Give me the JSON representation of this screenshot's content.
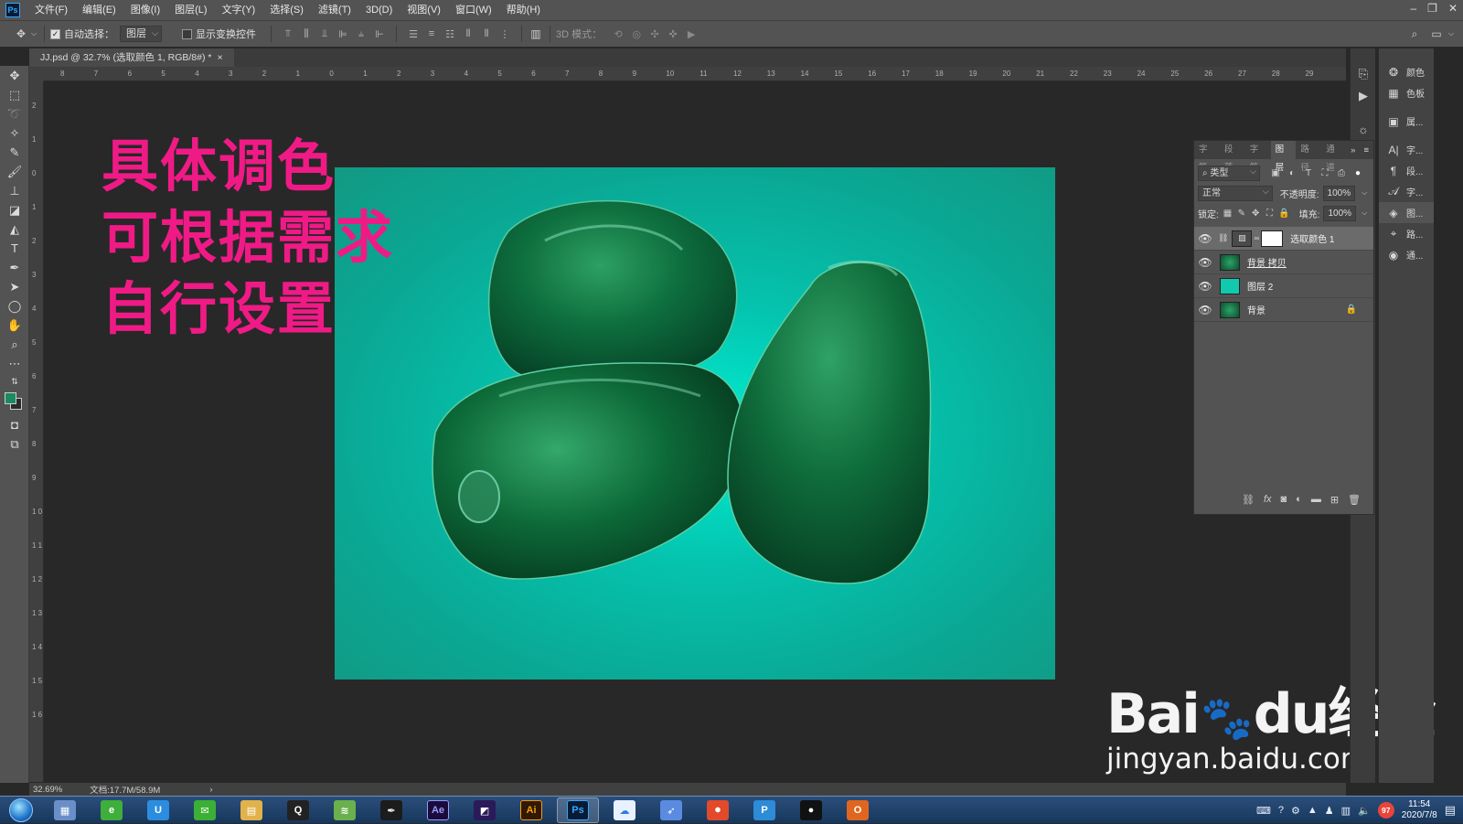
{
  "app": {
    "logo": "Ps",
    "menu": [
      "文件(F)",
      "编辑(E)",
      "图像(I)",
      "图层(L)",
      "文字(Y)",
      "选择(S)",
      "滤镜(T)",
      "3D(D)",
      "视图(V)",
      "窗口(W)",
      "帮助(H)"
    ]
  },
  "options_bar": {
    "auto_select_label": "自动选择：",
    "auto_select_checked": true,
    "auto_select_target": "图层",
    "show_transform_label": "显示变换控件",
    "show_transform_checked": false,
    "mode_3d_label": "3D 模式："
  },
  "document": {
    "tab_title": "JJ.psd @ 32.7% (选取颜色 1, RGB/8#) *",
    "close": "×",
    "zoom": "32.69%",
    "doc_size": "文档:17.7M/58.9M"
  },
  "ruler": {
    "top_ticks": [
      "8",
      "7",
      "6",
      "5",
      "4",
      "3",
      "2",
      "1",
      "0",
      "1",
      "2",
      "3",
      "4",
      "5",
      "6",
      "7",
      "8",
      "9",
      "10",
      "11",
      "12",
      "13",
      "14",
      "15",
      "16",
      "17",
      "18",
      "19",
      "20",
      "21",
      "22",
      "23",
      "24",
      "25",
      "26",
      "27",
      "28",
      "29"
    ],
    "left_ticks": [
      "2",
      "1",
      "0",
      "1",
      "2",
      "3",
      "4",
      "5",
      "6",
      "7",
      "8",
      "9",
      "1 0",
      "1 1",
      "1 2",
      "1 3",
      "1 4",
      "1 5",
      "1 6"
    ]
  },
  "canvas": {
    "overlay_lines": [
      "具体调色",
      "可根据需求",
      "自行设置"
    ],
    "overlay_color": "#f01a86",
    "background_gradient": [
      "#00eed2",
      "#129983"
    ]
  },
  "watermark": {
    "main": "Bai🐾du经验",
    "main_left": "Bai",
    "main_right": "du经验",
    "sub": "jingyan.baidu.com"
  },
  "right_panel_strip": {
    "items": [
      {
        "icon": "color-wheel-icon",
        "label": "颜色"
      },
      {
        "icon": "swatches-icon",
        "label": "色板"
      },
      {
        "icon": "properties-icon",
        "label": "属..."
      },
      {
        "icon": "character-icon",
        "label": "字..."
      },
      {
        "icon": "paragraph-icon",
        "label": "段..."
      },
      {
        "icon": "glyph-icon",
        "label": "字..."
      },
      {
        "icon": "layers-icon",
        "label": "图..."
      },
      {
        "icon": "paths-icon",
        "label": "路..."
      },
      {
        "icon": "channels-icon",
        "label": "通..."
      }
    ]
  },
  "layers_panel": {
    "tabs": [
      "字符",
      "段落",
      "字符",
      "图层",
      "路径",
      "通道"
    ],
    "active_tab_index": 3,
    "filter_kind": "类型",
    "blend_mode": "正常",
    "opacity_label": "不透明度:",
    "opacity_value": "100%",
    "lock_label": "锁定:",
    "fill_label": "填充:",
    "fill_value": "100%",
    "layers": [
      {
        "name": "选取颜色 1",
        "visible": true,
        "selected": true,
        "type": "adjustment",
        "locked": false
      },
      {
        "name": "背景 拷贝",
        "visible": true,
        "selected": false,
        "type": "image",
        "locked": false
      },
      {
        "name": "图层 2",
        "visible": true,
        "selected": false,
        "type": "fill",
        "locked": false
      },
      {
        "name": "背景",
        "visible": true,
        "selected": false,
        "type": "image",
        "locked": true
      }
    ]
  },
  "taskbar": {
    "apps": [
      {
        "id": "calculator",
        "glyph": "▦",
        "color": "#6a8fc8"
      },
      {
        "id": "browser-360",
        "glyph": "e",
        "color": "#3fae3a"
      },
      {
        "id": "uu",
        "glyph": "U",
        "color": "#2b8de0"
      },
      {
        "id": "wechat",
        "glyph": "✉",
        "color": "#3cb034"
      },
      {
        "id": "explorer",
        "glyph": "▤",
        "color": "#e2b24a"
      },
      {
        "id": "qq",
        "glyph": "Q",
        "color": "#222222"
      },
      {
        "id": "bamboo",
        "glyph": "≋",
        "color": "#6ab04c"
      },
      {
        "id": "pen-app",
        "glyph": "✒",
        "color": "#1c1c1c"
      },
      {
        "id": "after-effects",
        "glyph": "Ae",
        "color": "#1a0b3a"
      },
      {
        "id": "premiere-like",
        "glyph": "◩",
        "color": "#2a1a5a"
      },
      {
        "id": "illustrator",
        "glyph": "Ai",
        "color": "#2e1a05"
      },
      {
        "id": "photoshop",
        "glyph": "Ps",
        "color": "#0a1a33"
      },
      {
        "id": "baidu-netdisk",
        "glyph": "☁",
        "color": "#e8f1ff"
      },
      {
        "id": "feather",
        "glyph": "➶",
        "color": "#5b8be0"
      },
      {
        "id": "recorder",
        "glyph": "⏺",
        "color": "#e24a2a"
      },
      {
        "id": "pdf-reader",
        "glyph": "P",
        "color": "#2d8bd8"
      },
      {
        "id": "media",
        "glyph": "●",
        "color": "#111111"
      },
      {
        "id": "office",
        "glyph": "O",
        "color": "#e0661f"
      }
    ],
    "tray_badge": "97",
    "time": "11:54",
    "date": "2020/7/8"
  }
}
